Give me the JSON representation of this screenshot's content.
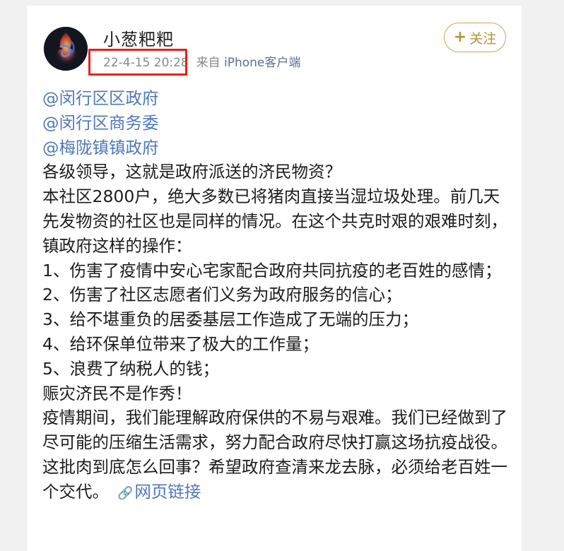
{
  "post": {
    "username": "小葱粑粑",
    "timestamp": "22-4-15 20:28",
    "source_prefix": "来自",
    "source": "iPhone客户端",
    "follow_label": "关注",
    "mentions": [
      "@闵行区区政府",
      "@闵行区商务委",
      "@梅陇镇镇政府"
    ],
    "lines": [
      "各级领导，这就是政府派送的济民物资？",
      "本社区2800户，绝大多数已将猪肉直接当湿垃圾处理。前几天先发物资的社区也是同样的情况。在这个共克时艰的艰难时刻，镇政府这样的操作：",
      "1、伤害了疫情中安心宅家配合政府共同抗疫的老百姓的感情；",
      "2、伤害了社区志愿者们义务为政府服务的信心；",
      "3、给不堪重负的居委基层工作造成了无端的压力；",
      "4、给环保单位带来了极大的工作量；",
      "5、浪费了纳税人的钱；",
      "赈灾济民不是作秀！",
      "疫情期间，我们能理解政府保供的不易与艰难。我们已经做到了尽可能的压缩生活需求，努力配合政府尽快打赢这场抗疫战役。",
      "这批肉到底怎么回事？希望政府查清来龙去脉，必须给老百姓一个交代。"
    ],
    "link_label": "网页链接"
  },
  "highlight_color": "#e8201e",
  "mention_color": "#4f78b8"
}
